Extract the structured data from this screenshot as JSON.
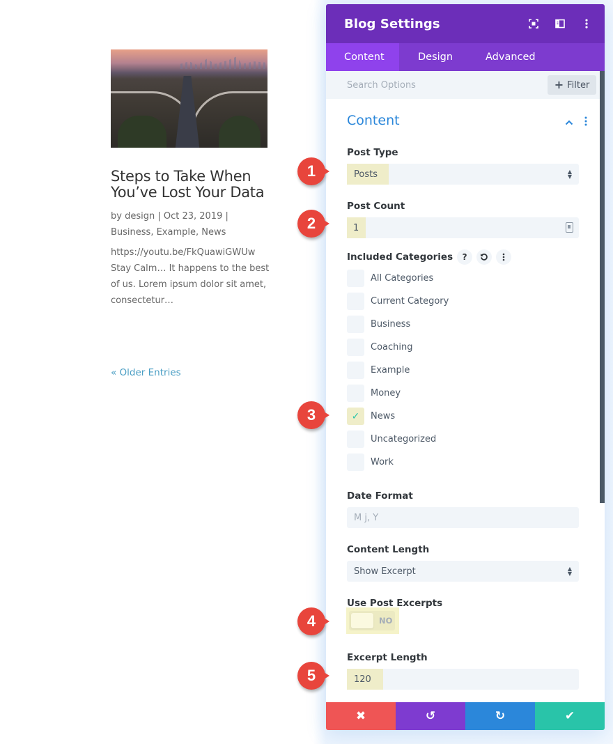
{
  "post": {
    "title": "Steps to Take When You’ve Lost Your Data",
    "meta_line1": "by design | Oct 23, 2019 |",
    "meta_line2": "Business, Example, News",
    "excerpt": "https://youtu.be/FkQuawiGWUw Stay Calm… It happens to the best of us. Lorem ipsum dolor sit amet, consectetur…",
    "image_alt": "aerial-highway-interchange-icon",
    "older_entries": "« Older Entries"
  },
  "modal": {
    "title": "Blog Settings",
    "header_icons": [
      "expand-icon",
      "sidebar-toggle-icon",
      "more-options-icon"
    ],
    "tabs": [
      {
        "label": "Content",
        "active": true
      },
      {
        "label": "Design",
        "active": false
      },
      {
        "label": "Advanced",
        "active": false
      }
    ],
    "search_placeholder": "Search Options",
    "filter_label": "Filter",
    "section_title": "Content",
    "fields": {
      "post_type": {
        "label": "Post Type",
        "value": "Posts"
      },
      "post_count": {
        "label": "Post Count",
        "value": "1"
      },
      "included_categories": {
        "label": "Included Categories",
        "help_glyph": "?",
        "items": [
          {
            "label": "All Categories",
            "checked": false
          },
          {
            "label": "Current Category",
            "checked": false
          },
          {
            "label": "Business",
            "checked": false
          },
          {
            "label": "Coaching",
            "checked": false
          },
          {
            "label": "Example",
            "checked": false
          },
          {
            "label": "Money",
            "checked": false
          },
          {
            "label": "News",
            "checked": true
          },
          {
            "label": "Uncategorized",
            "checked": false
          },
          {
            "label": "Work",
            "checked": false
          }
        ]
      },
      "date_format": {
        "label": "Date Format",
        "placeholder": "M j, Y"
      },
      "content_length": {
        "label": "Content Length",
        "value": "Show Excerpt"
      },
      "use_post_excerpts": {
        "label": "Use Post Excerpts",
        "value": "NO"
      },
      "excerpt_length": {
        "label": "Excerpt Length",
        "value": "120"
      }
    },
    "footer": {
      "cancel_glyph": "✖",
      "undo_glyph": "↺",
      "redo_glyph": "↻",
      "save_glyph": "✔"
    },
    "colors": {
      "header": "#6c2eb9",
      "tabs": "#7d3bcf",
      "active_tab": "#8f42ec",
      "accent_blue": "#2b87da",
      "highlight": "#efedc9",
      "cancel": "#ef5555",
      "undo": "#7e3bd0",
      "redo": "#2b87da",
      "save": "#29c4a9",
      "marker": "#e8453c"
    }
  },
  "markers": [
    "1",
    "2",
    "3",
    "4",
    "5"
  ]
}
